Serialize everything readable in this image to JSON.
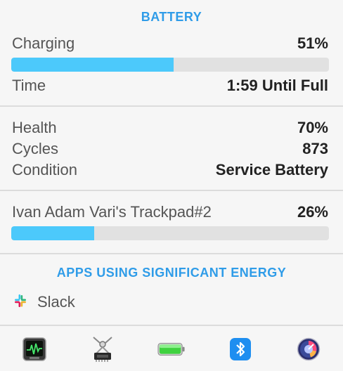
{
  "battery": {
    "title": "BATTERY",
    "charging_label": "Charging",
    "charging_value": "51%",
    "charging_level": 0.51,
    "time_label": "Time",
    "time_value": "1:59 Until Full"
  },
  "health": {
    "health_label": "Health",
    "health_value": "70%",
    "cycles_label": "Cycles",
    "cycles_value": "873",
    "condition_label": "Condition",
    "condition_value": "Service Battery"
  },
  "device": {
    "name": "Ivan Adam Vari's Trackpad#2",
    "value": "26%",
    "level": 0.26
  },
  "apps": {
    "title": "APPS USING SIGNIFICANT ENERGY",
    "items": [
      {
        "label": "Slack",
        "icon": "slack-icon"
      }
    ]
  },
  "toolbar": {
    "items": [
      {
        "icon": "activity-monitor-icon"
      },
      {
        "icon": "system-information-icon"
      },
      {
        "icon": "battery-icon"
      },
      {
        "icon": "bluetooth-icon"
      },
      {
        "icon": "istat-menus-icon"
      }
    ]
  },
  "colors": {
    "accent": "#2f9ce8",
    "bar_fill": "#4cc9fb",
    "bar_track": "#e1e1e1"
  }
}
